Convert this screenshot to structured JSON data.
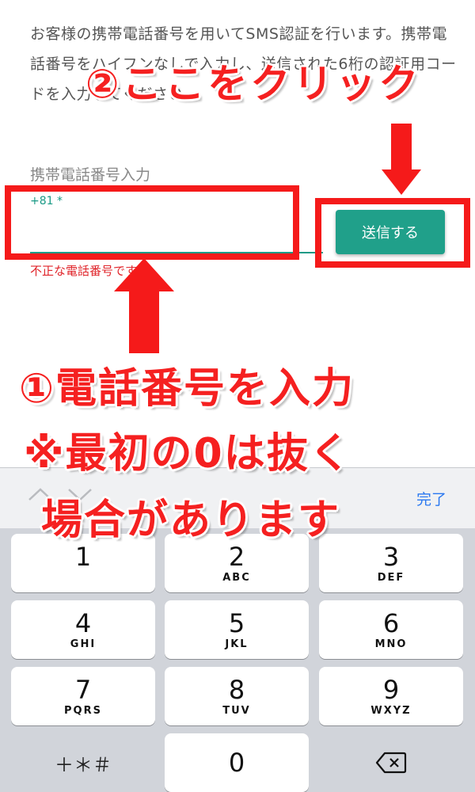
{
  "instructions": "お客様の携帯電話番号を用いてSMS認証を行います。携帯電話番号をハイフンなしで入力し、送信された6桁の認証用コードを入力してください",
  "phone": {
    "label": "携帯電話番号入力",
    "prefix": "+81",
    "required_mark": "*",
    "value": "",
    "error": "不正な電話番号です"
  },
  "send_button_label": "送信する",
  "annotations": {
    "step2": "②ここをクリック",
    "step1": "①電話番号を入力",
    "note_line1": "※最初の0は抜く",
    "note_line2": "場合があります",
    "color": "#f51a1a"
  },
  "keyboard": {
    "done_label": "完了",
    "keys": [
      {
        "digit": "1",
        "letters": ""
      },
      {
        "digit": "2",
        "letters": "ABC"
      },
      {
        "digit": "3",
        "letters": "DEF"
      },
      {
        "digit": "4",
        "letters": "GHI"
      },
      {
        "digit": "5",
        "letters": "JKL"
      },
      {
        "digit": "6",
        "letters": "MNO"
      },
      {
        "digit": "7",
        "letters": "PQRS"
      },
      {
        "digit": "8",
        "letters": "TUV"
      },
      {
        "digit": "9",
        "letters": "WXYZ"
      },
      {
        "symbols": "＋＊＃"
      },
      {
        "digit": "0",
        "letters": ""
      }
    ]
  },
  "colors": {
    "accent": "#20a08a",
    "error": "#e0242a",
    "link": "#2a78f0"
  }
}
